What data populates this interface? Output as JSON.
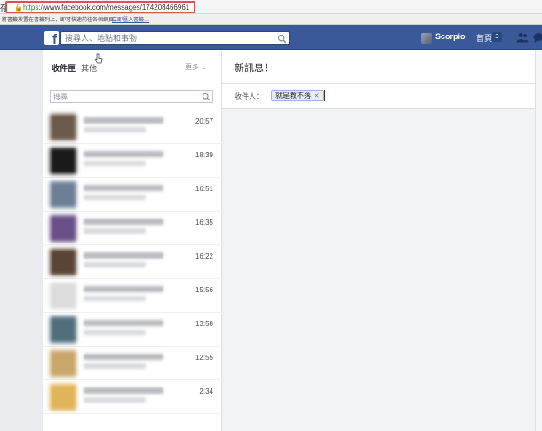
{
  "browser": {
    "edge_glyph": "存",
    "url_scheme": "https://",
    "url_rest": "www.facebook.com/messages/174208466961",
    "bookmarks_text": "將書籤放置在書籤列上，即可快速前往各個網頁。",
    "bookmarks_link": "立即匯入書籤…"
  },
  "header": {
    "logo": "f",
    "search_placeholder": "搜尋人、地點和事物",
    "username": "Scorpio",
    "home_label": "首頁",
    "home_count": "3"
  },
  "inbox": {
    "tab_inbox": "收件匣",
    "tab_other": "其他",
    "more_label": "更多 ⌄",
    "search_placeholder": "搜尋",
    "conversations": [
      {
        "time": "20:57",
        "thumb": "#6b5a4a"
      },
      {
        "time": "18:39",
        "thumb": "#1a1a1a"
      },
      {
        "time": "16:51",
        "thumb": "#6d7f96"
      },
      {
        "time": "16:35",
        "thumb": "#6a4f86"
      },
      {
        "time": "16:22",
        "thumb": "#5a4436"
      },
      {
        "time": "15:56",
        "thumb": "#dcdcdc"
      },
      {
        "time": "13:58",
        "thumb": "#4f6f7d"
      },
      {
        "time": "12:55",
        "thumb": "#c9a76a"
      },
      {
        "time": "2:34",
        "thumb": "#e0b45a"
      }
    ]
  },
  "compose": {
    "title": "新訊息！",
    "to_label": "收件人：",
    "recipient": "就是教不落",
    "remove_glyph": "×"
  }
}
